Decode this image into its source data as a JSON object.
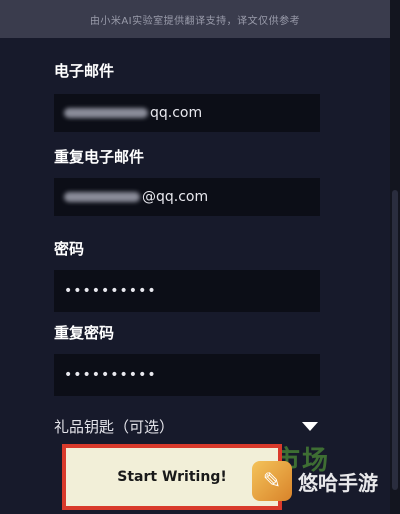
{
  "banner": {
    "text": "由小米AI实验室提供翻译支持，译文仅供参考"
  },
  "form": {
    "email": {
      "label": "电子邮件",
      "value_suffix": "qq.com"
    },
    "email_repeat": {
      "label": "重复电子邮件",
      "value_suffix": "@qq.com"
    },
    "password": {
      "label": "密码",
      "value": "••••••••••"
    },
    "password_repeat": {
      "label": "重复密码",
      "value": "••••••••••"
    },
    "gift_key": {
      "label": "礼品钥匙（可选）"
    }
  },
  "submit": {
    "label": "Start Writing!"
  },
  "watermark": {
    "text": "悠哈手游",
    "green_text": "牛情市场"
  },
  "colors": {
    "background": "#171a2b",
    "field": "#0c0e17",
    "button": "#f2efd8",
    "highlight": "#d93a2b"
  }
}
